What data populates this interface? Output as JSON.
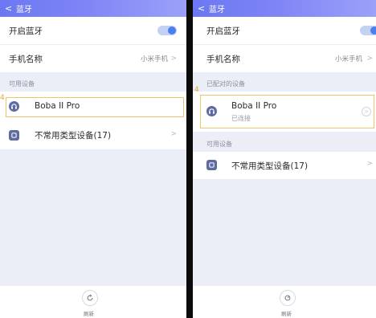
{
  "left": {
    "header": {
      "back_glyph": "<",
      "title": "蓝牙"
    },
    "bluetooth_toggle": {
      "label": "开启蓝牙",
      "on": true
    },
    "device_name": {
      "label": "手机名称",
      "value": "小米手机",
      "chevron": ">"
    },
    "available_section": {
      "label": "可用设备"
    },
    "devices": [
      {
        "name": "Boba II Pro",
        "icon": "headphones-icon",
        "highlighted": true
      },
      {
        "name": "不常用类型设备(17)",
        "icon": "device-icon",
        "chevron": ">"
      }
    ],
    "marker": "4",
    "footer": {
      "refresh_label": "刷新",
      "refresh_icon": "refresh-icon"
    }
  },
  "right": {
    "header": {
      "back_glyph": "<",
      "title": "蓝牙"
    },
    "bluetooth_toggle": {
      "label": "开启蓝牙",
      "on": true
    },
    "device_name": {
      "label": "手机名称",
      "value": "小米手机",
      "chevron": ">"
    },
    "paired_section": {
      "label": "已配对的设备"
    },
    "paired_device": {
      "name": "Boba II Pro",
      "status": "已连接",
      "icon": "headphones-icon",
      "info_glyph": ">"
    },
    "available_section": {
      "label": "可用设备"
    },
    "devices": [
      {
        "name": "不常用类型设备(17)",
        "icon": "device-icon",
        "chevron": ">"
      }
    ],
    "marker": "4",
    "footer": {
      "refresh_label": "刷新",
      "refresh_icon": "refresh-icon"
    }
  },
  "colors": {
    "header_gradient_start": "#6b78f2",
    "accent_toggle": "#4a7ff0",
    "highlight_border": "#f1c46b",
    "icon_fill": "#5f6ba0"
  }
}
